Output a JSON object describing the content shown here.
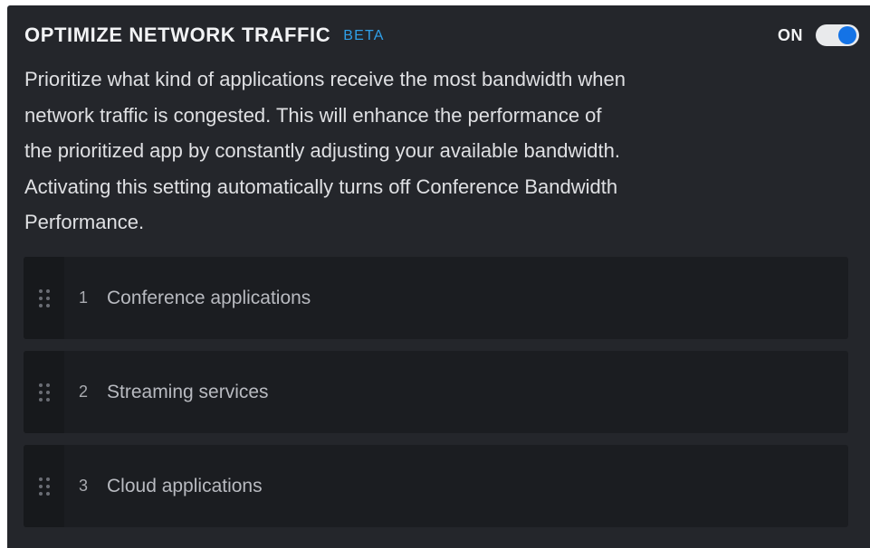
{
  "header": {
    "title": "OPTIMIZE NETWORK TRAFFIC",
    "badge": "BETA",
    "toggle": {
      "state_label": "ON",
      "enabled": true,
      "track_color": "#e9eaec",
      "knob_color": "#1473e6"
    }
  },
  "description": {
    "lines": [
      "Prioritize what kind of applications receive the most bandwidth when",
      "network traffic is congested. This will enhance the performance of",
      "the prioritized app by constantly  adjusting your available bandwidth.",
      "Activating this setting automatically turns off Conference Bandwidth",
      "Performance."
    ]
  },
  "priority_list": {
    "items": [
      {
        "rank": "1",
        "label": "Conference applications",
        "handle_icon": "drag-handle-icon"
      },
      {
        "rank": "2",
        "label": "Streaming services",
        "handle_icon": "drag-handle-icon"
      },
      {
        "rank": "3",
        "label": "Cloud applications",
        "handle_icon": "drag-handle-icon"
      }
    ]
  },
  "colors": {
    "panel_background": "#24262b",
    "item_background": "#1b1d21",
    "accent": "#2f9fe8"
  }
}
